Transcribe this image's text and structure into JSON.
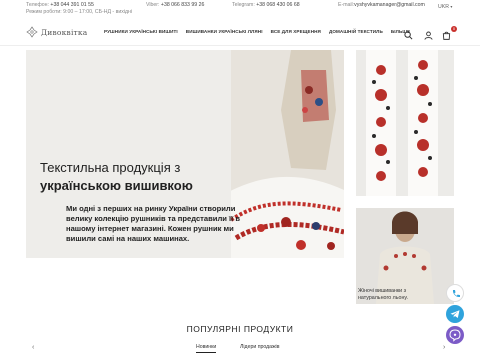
{
  "topbar": {
    "phone_label": "Телефон:",
    "phone_value": "+38 044 391 01 55",
    "hours_label": "Режим роботи:",
    "hours_value": "9:00 – 17:00, СБ-НД - вихідні",
    "viber_label": "Viber:",
    "viber_value": "+38 066 833 99 26",
    "telegram_label": "Telegram:",
    "telegram_value": "+38 068 430 06 68",
    "email_label": "E-mail:",
    "email_value": "vyshyvkamanager@gmail.com",
    "language": "UKR"
  },
  "header": {
    "logo_text": "Дивоквітка",
    "nav": [
      "РУШНИКИ УКРАЇНСЬКІ ВИШИТІ",
      "ВИШИВАНКИ УКРАЇНСЬКІ ЛЛЯНІ",
      "ВСЕ ДЛЯ ХРЕЩЕННЯ",
      "ДОМАШНІЙ ТЕКСТИЛЬ",
      "БІЛЬШЕ"
    ],
    "cart_count": "0"
  },
  "hero": {
    "title_line1": "Текстильна продукція з",
    "title_line2": "українською вишивкою",
    "text": "Ми одні з перших на ринку України створили велику колекцію рушників та представили її в нашому інтернет магазині. Кожен рушник ми вишили самі на наших машинах."
  },
  "side_banner": {
    "caption": "Жіночі вишиванки з натурального льону."
  },
  "popular": {
    "title": "ПОПУЛЯРНІ ПРОДУКТИ",
    "tabs": [
      "Новинки",
      "Лідери продажів"
    ],
    "prev_arrow": "‹",
    "next_arrow": "›"
  },
  "colors": {
    "accent_red": "#c9302c",
    "telegram": "#2fa3dc",
    "viber": "#7c5bc7",
    "phone_fab": "#ffffff"
  }
}
